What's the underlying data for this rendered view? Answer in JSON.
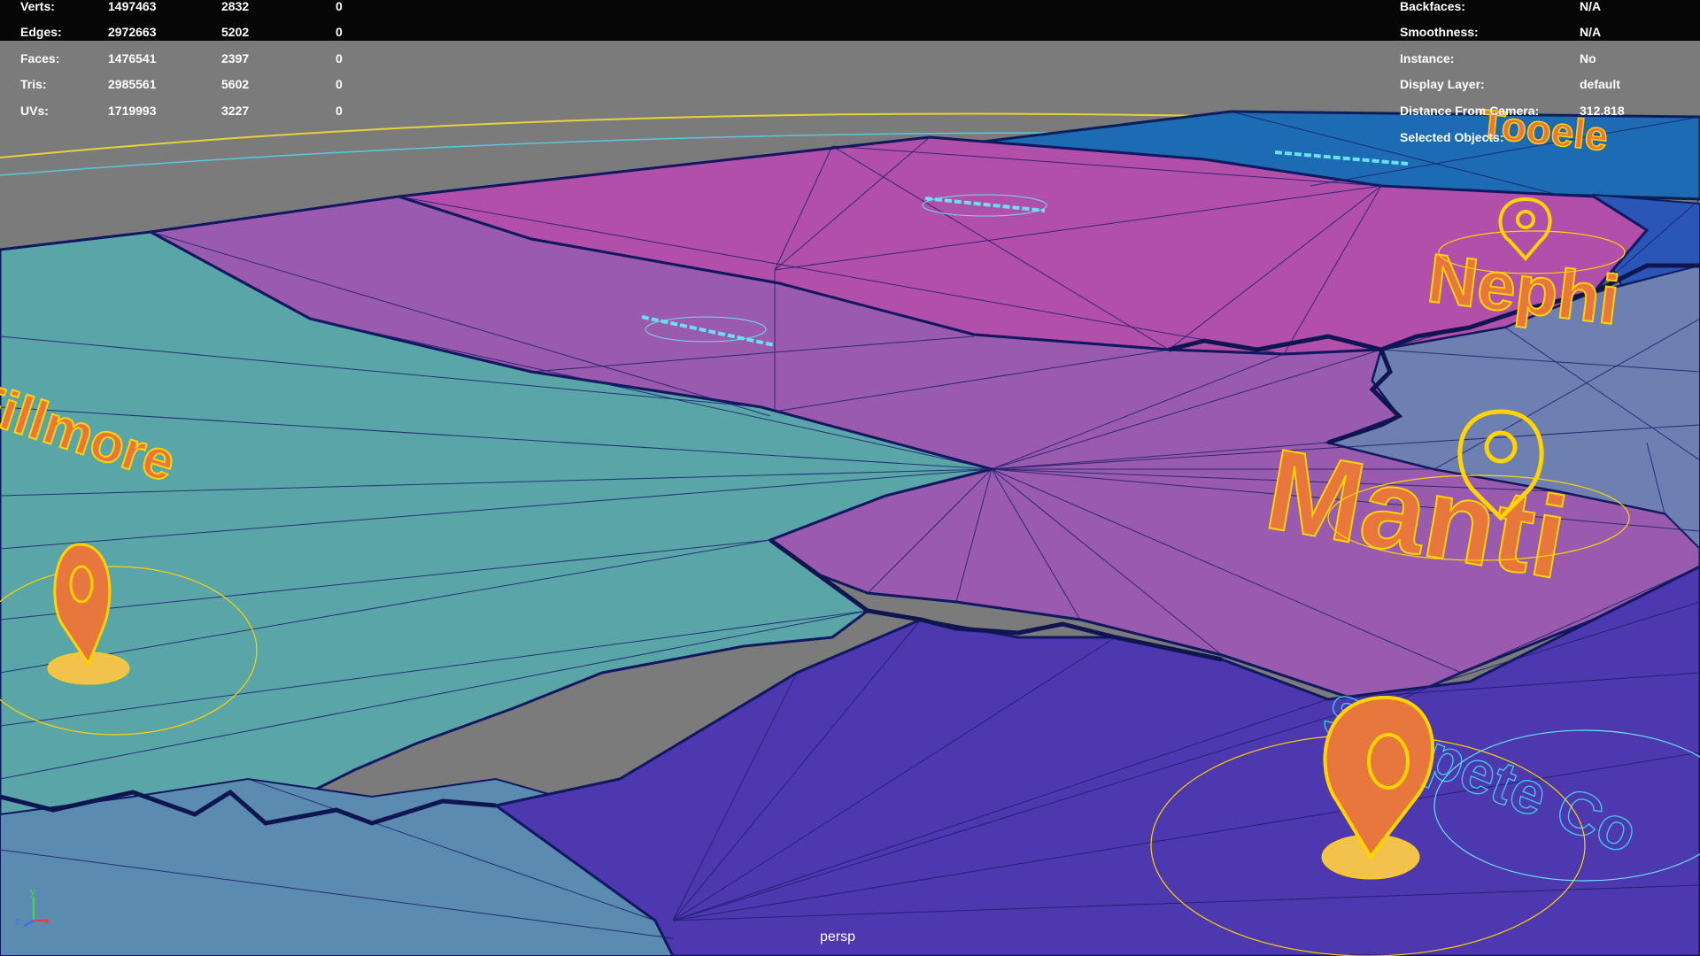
{
  "hud_left": {
    "rows": [
      {
        "label": "Verts:",
        "total": "1497463",
        "selected": "2832",
        "tri": "0"
      },
      {
        "label": "Edges:",
        "total": "2972663",
        "selected": "5202",
        "tri": "0"
      },
      {
        "label": "Faces:",
        "total": "1476541",
        "selected": "2397",
        "tri": "0"
      },
      {
        "label": "Tris:",
        "total": "2985561",
        "selected": "5602",
        "tri": "0"
      },
      {
        "label": "UVs:",
        "total": "1719993",
        "selected": "3227",
        "tri": "0"
      }
    ]
  },
  "hud_right": {
    "rows": [
      {
        "label": "Backfaces:",
        "value": "N/A"
      },
      {
        "label": "Smoothness:",
        "value": "N/A"
      },
      {
        "label": "Instance:",
        "value": "No"
      },
      {
        "label": "Display Layer:",
        "value": "default"
      },
      {
        "label": "Distance From Camera:",
        "value": "312.818"
      },
      {
        "label": "Selected Objects:",
        "value": ""
      }
    ]
  },
  "city_labels": {
    "fillmore": "Fillmore",
    "nephi": "Nephi",
    "manti": "Manti",
    "tooele": "Tooele"
  },
  "county_label_partial": "Sanpete Co",
  "camera_label": "persp",
  "axes": {
    "y": "y",
    "z": "z",
    "x": "x"
  },
  "colors": {
    "teal_region": "#5aa6a8",
    "magenta_region": "#b24fae",
    "purple_region": "#9a5cb0",
    "indigo_region": "#4e38b0",
    "blue_region": "#1f6fb5",
    "background": "#7a7a7a",
    "wireframe": "#1b1f6e",
    "city_fill": "#e8773e",
    "city_outline": "#ffd400",
    "county_outline": "#3fd0e8"
  },
  "icons": [
    "location-pin-icon",
    "axis-gizmo-icon"
  ]
}
